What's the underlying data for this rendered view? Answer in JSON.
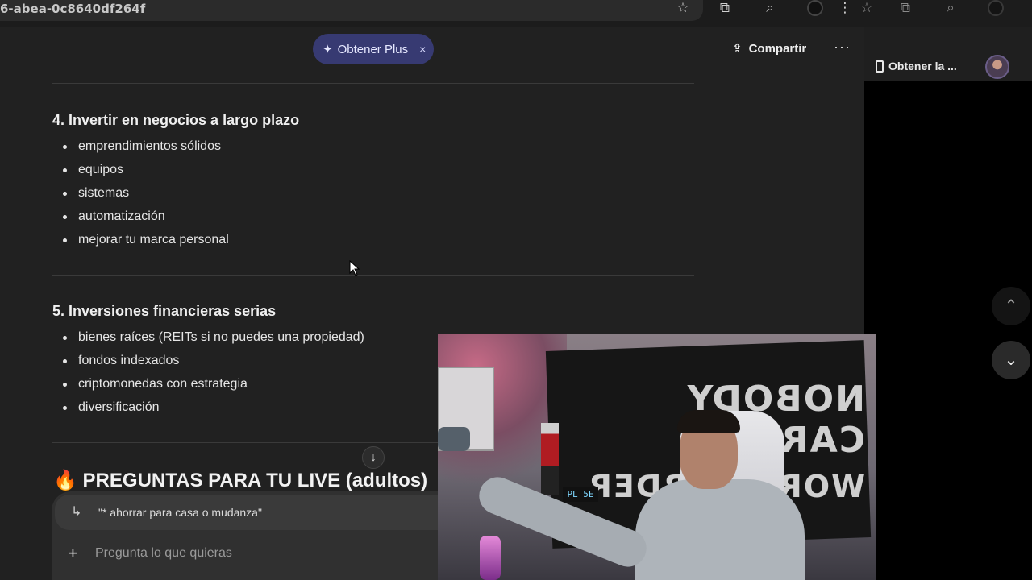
{
  "browser": {
    "url_fragment": "6-abea-0c8640df264f",
    "icons": [
      "star-icon",
      "extensions-icon",
      "tab-search-icon",
      "profile-icon",
      "menu-icon"
    ]
  },
  "header": {
    "plus_button_label": "Obtener Plus",
    "plus_close": "×",
    "share_label": "Compartir",
    "more_label": "···"
  },
  "sections": [
    {
      "title": "4. Invertir en negocios a largo plazo",
      "items": [
        "emprendimientos sólidos",
        "equipos",
        "sistemas",
        "automatización",
        "mejorar tu marca personal"
      ]
    },
    {
      "title": "5. Inversiones financieras serias",
      "items": [
        "bienes raíces (REITs si no puedes una propiedad)",
        "fondos indexados",
        "criptomonedas con estrategia",
        "diversificación"
      ]
    }
  ],
  "questions_heading": "🔥 PREGUNTAS PARA TU LIVE (adultos)",
  "scroll_down_icon": "↓",
  "composer": {
    "quote_arrow": "↳",
    "quoted_text": "\"* ahorrar para casa o mudanza\"",
    "add_icon": "+",
    "placeholder": "Pregunta lo que quieras"
  },
  "side_panel": {
    "app_button_label": "Obtener la ...",
    "nav_up": "⌃",
    "nav_down": "⌄"
  },
  "webcam": {
    "banner_text": "NOBODY CARES",
    "banner_text_2": "WORK HARDER",
    "clock_text": "PL 5E"
  }
}
